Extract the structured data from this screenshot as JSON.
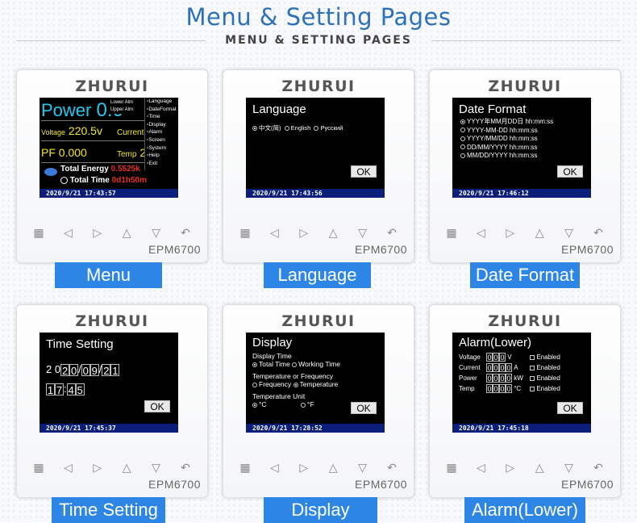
{
  "header": {
    "title": "Menu & Setting Pages",
    "subtitle": "MENU & SETTING PAGES"
  },
  "device": {
    "brand": "ZHURUI",
    "model": "EPM6700"
  },
  "panels": {
    "menu": {
      "label": "Menu",
      "power": "Power",
      "power_val": "0.0",
      "voltage": "Voltage",
      "voltage_val": "220.5v",
      "current": "Current",
      "current_val": "0",
      "pf": "PF",
      "pf_val": "0.000",
      "temp": "Temp",
      "temp_val": "26",
      "total_energy": "Total Energy",
      "total_energy_val": "0.5525k",
      "total_time": "Total Time",
      "total_time_val": "0d1h50m",
      "lower_alm": "Lower Alm",
      "upper_alm": "Upper Alm",
      "menu_items": [
        "Language",
        "DateFormat",
        "Time",
        "Display",
        "Alarm",
        "Screen",
        "System",
        "Help",
        "Exit"
      ],
      "status": "2020/9/21 17:43:57"
    },
    "language": {
      "label": "Language",
      "title": "Language",
      "options": [
        "中文(简)",
        "English",
        "Русский"
      ],
      "ok": "OK",
      "status": "2020/9/21 17:43:56"
    },
    "date_format": {
      "label": "Date Format",
      "title": "Date Format",
      "options": [
        "YYYY年MM月DD日 hh:mm:ss",
        "YYYY-MM-DD hh:mm:ss",
        "YYYY/MM/DD hh:mm:ss",
        "DD/MM/YYYY hh:mm:ss",
        "MM/DD/YYYY hh:mm:ss"
      ],
      "ok": "OK",
      "status": "2020/9/21 17:46:12"
    },
    "time_setting": {
      "label": "Time Setting",
      "title": "Time Setting",
      "date_digits": [
        "2",
        "0",
        "2",
        "0",
        "0",
        "9",
        "2",
        "1"
      ],
      "time_digits": [
        "1",
        "7",
        "4",
        "5"
      ],
      "sep_slash": "/",
      "sep_colon": ":",
      "ok": "OK",
      "status": "2020/9/21 17:45:37"
    },
    "display": {
      "label": "Display",
      "title": "Display",
      "display_time": "Display Time",
      "total_time": "Total Time",
      "working_time": "Working Time",
      "temp_or_freq": "Temperature or Frequency",
      "frequency": "Frequency",
      "temperature": "Temperature",
      "temp_unit": "Temperature Unit",
      "unit_c": "°C",
      "unit_f": "°F",
      "ok": "OK",
      "status": "2020/9/21 17:28:52"
    },
    "alarm": {
      "label": "Alarm(Lower)",
      "title": "Alarm(Lower)",
      "rows": [
        {
          "name": "Voltage",
          "digits": [
            "0",
            "0",
            "0"
          ],
          "unit": "V",
          "enabled": "Enabled"
        },
        {
          "name": "Current",
          "digits": [
            "0",
            "0",
            "0",
            "0"
          ],
          "unit": "A",
          "enabled": "Enabled"
        },
        {
          "name": "Power",
          "digits": [
            "0",
            "0",
            "0",
            "0"
          ],
          "unit": "kW",
          "enabled": "Enabled"
        },
        {
          "name": "Temp",
          "digits": [
            "0",
            "0",
            "0",
            "0"
          ],
          "unit": "°C",
          "enabled": "Enabled"
        }
      ],
      "ok": "OK",
      "status": "2020/9/21 17:45:18"
    }
  },
  "colors": {
    "accent": "#2d86e6",
    "title": "#2d72b8",
    "status_bar": "#0a1e7a",
    "cyan": "#22c8f0",
    "yellow": "#f5e71a",
    "red": "#e83020"
  }
}
